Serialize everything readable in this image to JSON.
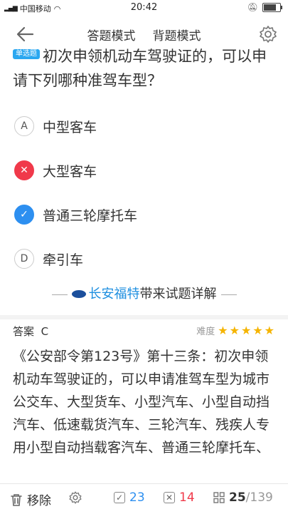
{
  "status": {
    "carrier": "中国移动",
    "time": "20:42"
  },
  "header": {
    "tabs": [
      "答题模式",
      "背题模式"
    ],
    "active_tab": 0
  },
  "question": {
    "tag": "单选题",
    "text": "初次申领机动车驾驶证的，可以申请下列哪种准驾车型？"
  },
  "options": [
    {
      "key": "A",
      "text": "中型客车",
      "state": "normal"
    },
    {
      "key": "B",
      "text": "大型客车",
      "state": "wrong"
    },
    {
      "key": "C",
      "text": "普通三轮摩托车",
      "state": "right"
    },
    {
      "key": "D",
      "text": "牵引车",
      "state": "normal"
    }
  ],
  "sponsor": {
    "brand": "长安福特",
    "suffix": "带来试题详解"
  },
  "answer": {
    "label": "答案",
    "value": "C",
    "difficulty_label": "难度",
    "stars": "★★★★★",
    "difficulty_level": 5
  },
  "explanation": "《公安部令第123号》第十三条：初次申领机动车驾驶证的，可以申请准驾车型为城市公交车、大型货车、小型汽车、小型自动挡汽车、低速载货汽车、三轮汽车、残疾人专用小型自动挡载客汽车、普通三轮摩托车、",
  "bottom": {
    "remove_label": "移除",
    "right_count": "23",
    "wrong_count": "14",
    "current": "25",
    "total": "/139"
  },
  "colors": {
    "accent": "#2d8ff0",
    "wrong": "#f0394a",
    "star": "#f5b400"
  }
}
